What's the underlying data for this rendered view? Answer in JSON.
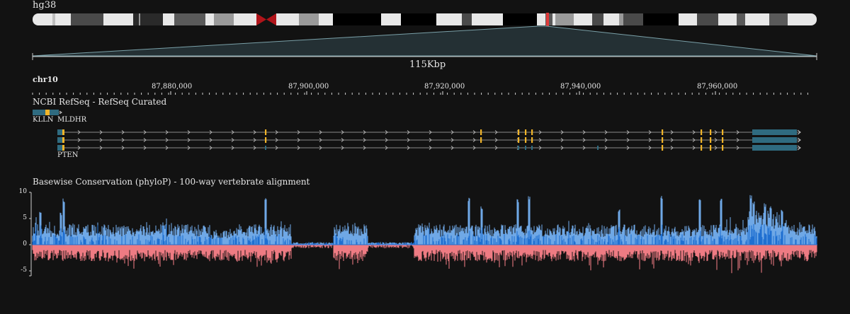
{
  "genome": "hg38",
  "span_label": "115Kbp",
  "chromosome": "chr10",
  "ruler_ticks": [
    "87,880,000",
    "87,900,000",
    "87,920,000",
    "87,940,000",
    "87,960,000"
  ],
  "genes_track": {
    "title": "NCBI RefSeq - RefSeq Curated",
    "gene_labels": [
      "KLLN",
      "MLDHR",
      "PTEN"
    ],
    "colors": {
      "exon": "#2f6b80",
      "highlight": "#f0b429",
      "intron": "#8a8a8a"
    }
  },
  "conservation_track": {
    "title": "Basewise Conservation (phyloP) - 100-way vertebrate alignment",
    "y_ticks": [
      "10",
      "5",
      "0",
      "-5"
    ],
    "colors": {
      "positive": "#6fa8e6",
      "positive_dark": "#1f6fd1",
      "negative": "#ee7b83"
    }
  },
  "colors": {
    "background": "#121212",
    "centromere": "#b0141a",
    "ideogram_highlight": "#e03a3a"
  }
}
